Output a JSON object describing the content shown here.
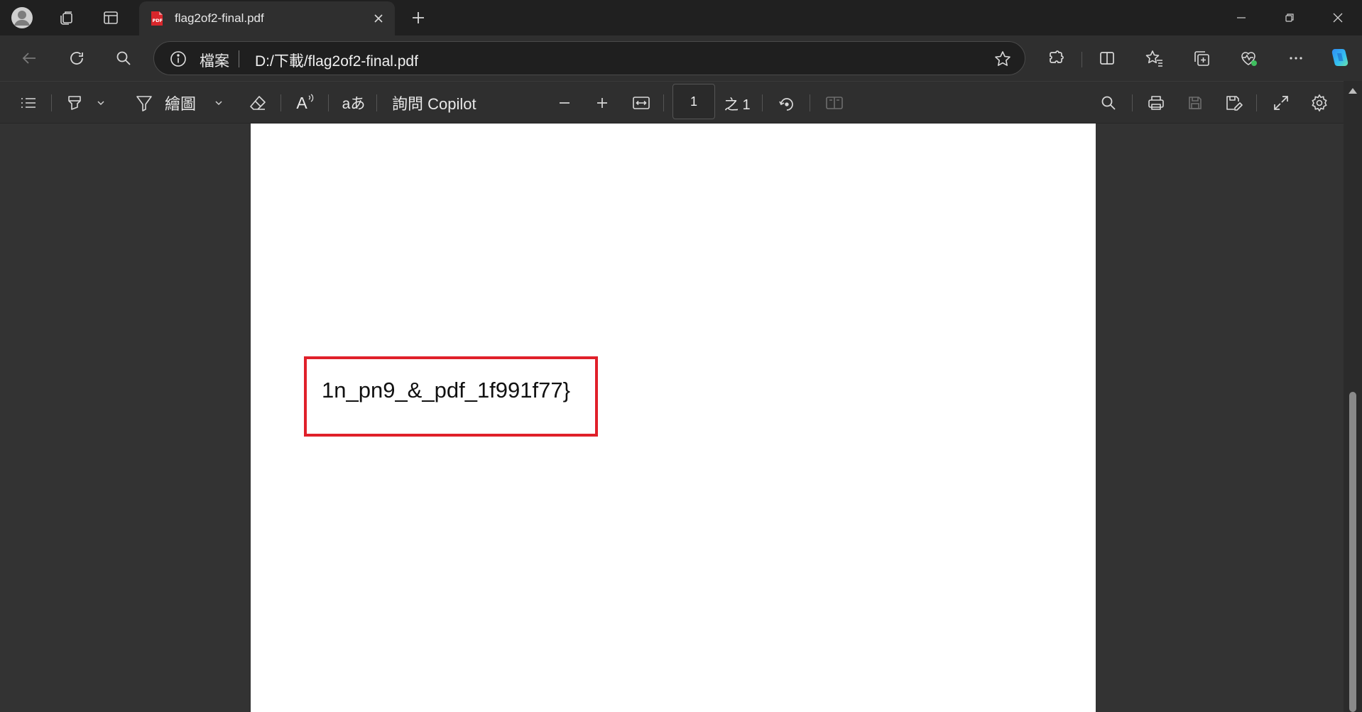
{
  "tab": {
    "title": "flag2of2-final.pdf",
    "favicon_text": "PDF"
  },
  "address": {
    "label": "檔案",
    "url": "D:/下載/flag2of2-final.pdf"
  },
  "pdf_toolbar": {
    "draw_label": "繪圖",
    "translate_glyph": "aあ",
    "read_glyph": "A",
    "copilot_label": "詢問 Copilot",
    "page_current": "1",
    "page_of": "之 1"
  },
  "document": {
    "boxed_text": "1n_pn9_&_pdf_1f991f77}"
  },
  "colors": {
    "titlebar": "#202020",
    "toolbar": "#2f2f2f",
    "viewer_bg": "#333333",
    "highlight_box": "#e0202a",
    "pdf_favicon": "#d9262b",
    "copilot_gradient": [
      "#2f8cf4",
      "#35c1f1",
      "#6be0a6"
    ]
  },
  "icons": {
    "titlebar": [
      "profile-avatar-icon",
      "workspaces-icon",
      "vertical-tabs-icon",
      "pdf-file-icon",
      "close-icon",
      "plus-icon",
      "minimize-icon",
      "restore-icon",
      "close-window-icon"
    ],
    "nav": [
      "back-arrow-icon",
      "refresh-icon",
      "search-icon",
      "info-icon",
      "star-icon",
      "extensions-icon",
      "split-screen-icon",
      "favorites-icon",
      "collections-icon",
      "browser-essentials-icon",
      "more-icon",
      "copilot-icon"
    ],
    "pdf": [
      "contents-icon",
      "highlight-icon",
      "chevron-down-icon",
      "draw-icon",
      "eraser-icon",
      "read-aloud-icon",
      "translate-icon",
      "zoom-out-icon",
      "zoom-in-icon",
      "fit-width-icon",
      "rotate-icon",
      "page-view-icon",
      "find-icon",
      "print-icon",
      "save-icon",
      "save-as-icon",
      "fullscreen-icon",
      "settings-icon"
    ]
  }
}
